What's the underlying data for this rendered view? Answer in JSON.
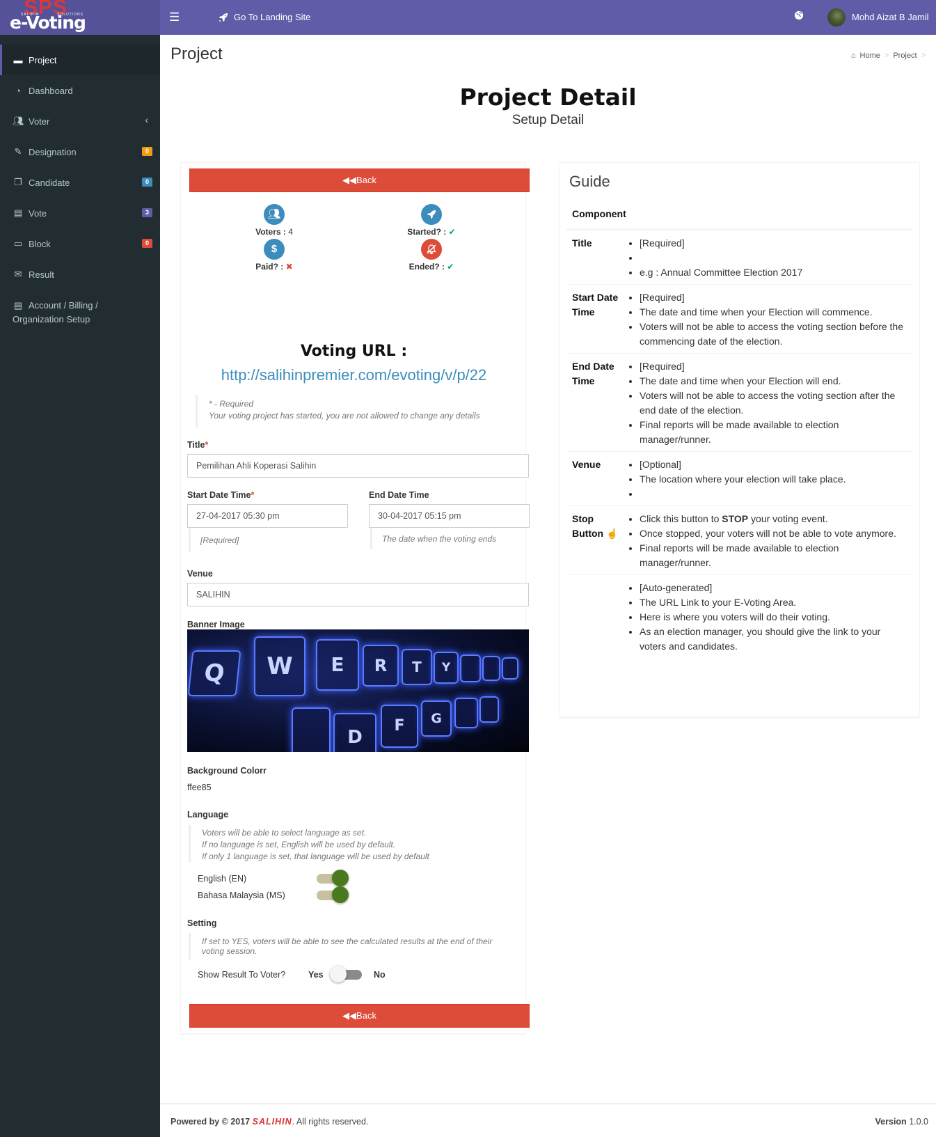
{
  "app": {
    "logo_top": "SPS",
    "logo_tag_left": "SALIHIN",
    "logo_tag_right": "SOLUTIONS",
    "logo_main": "e-Voting",
    "landing_label": "Go To Landing Site",
    "user_name": "Mohd Aizat B Jamil"
  },
  "sidebar": {
    "items": [
      {
        "label": "Project",
        "icon": "briefcase-icon"
      },
      {
        "label": "Dashboard",
        "icon": "dashboard-icon"
      },
      {
        "label": "Voter",
        "icon": "users-icon"
      },
      {
        "label": "Designation",
        "icon": "edit-icon",
        "badge": "0",
        "badge_color": "#f39c12"
      },
      {
        "label": "Candidate",
        "icon": "copy-icon",
        "badge": "0",
        "badge_color": "#3c8dbc"
      },
      {
        "label": "Vote",
        "icon": "book-icon",
        "badge": "3",
        "badge_color": "#605ca8"
      },
      {
        "label": "Block",
        "icon": "laptop-icon",
        "badge": "0",
        "badge_color": "#dd4b39"
      },
      {
        "label": "Result",
        "icon": "envelope-icon"
      }
    ],
    "account_line1": "Account / Billing /",
    "account_line2": "Organization Setup"
  },
  "page": {
    "title": "Project",
    "breadcrumb": [
      "Home",
      "Project"
    ],
    "heading": "Project Detail",
    "subheading": "Setup Detail"
  },
  "form": {
    "back_label": "Back",
    "stats": {
      "voters_label": "Voters :",
      "voters_value": "4",
      "started_label": "Started? :",
      "paid_label": "Paid? :",
      "ended_label": "Ended? :"
    },
    "voting_url_label": "Voting URL :",
    "voting_url": "http://salihinpremier.com/evoting/v/p/22",
    "notice_required": "* - Required",
    "notice_started": "Your voting project has started, you are not allowed to change any details",
    "title_label": "Title",
    "title_value": "Pemilihan Ahli Koperasi Salihin",
    "start_label": "Start Date Time",
    "start_value": "27-04-2017 05:30 pm",
    "start_help": "[Required]",
    "end_label": "End Date Time",
    "end_value": "30-04-2017 05:15 pm",
    "end_help": "The date when the voting ends",
    "venue_label": "Venue",
    "venue_value": "SALIHIN",
    "banner_label": "Banner Image",
    "banner_keys": [
      "Q",
      "W",
      "E",
      "R",
      "T",
      "Y",
      "D",
      "F",
      "G"
    ],
    "bgcolor_label": "Background Colorr",
    "bgcolor_value": "ffee85",
    "language_label": "Language",
    "language_help": [
      "Voters will be able to select language as set.",
      "If no language is set, English will be used by default.",
      "If only 1 language is set, that language will be used by default"
    ],
    "languages": [
      {
        "name": "English (EN)",
        "enabled": true
      },
      {
        "name": "Bahasa Malaysia (MS)",
        "enabled": true
      }
    ],
    "setting_label": "Setting",
    "setting_help": [
      "If set to YES, voters will be able to see the calculated results at the end of their",
      "voting session."
    ],
    "show_result_label": "Show Result To Voter?",
    "yes_label": "Yes",
    "no_label": "No",
    "show_result_enabled": false
  },
  "guide": {
    "title": "Guide",
    "column": "Component",
    "rows": [
      {
        "name": "Title",
        "items": [
          "[Required]",
          "",
          "e.g : Annual Committee Election 2017"
        ]
      },
      {
        "name": "Start Date Time",
        "items": [
          "[Required]",
          "The date and time when your Election will commence.",
          "Voters will not be able to access the voting section before the commencing date of the election."
        ]
      },
      {
        "name": "End Date Time",
        "items": [
          "[Required]",
          "The date and time when your Election will end.",
          "Voters will not be able to access the voting section after the end date of the election.",
          "Final reports will be made available to election manager/runner."
        ]
      },
      {
        "name": "Venue",
        "items": [
          "[Optional]",
          "The location where your election will take place.",
          ""
        ]
      },
      {
        "name": "Stop Button",
        "items": [
          "Click this button to STOP your voting event.",
          "Once stopped, your voters will not be able to vote anymore.",
          "Final reports will be made available to election manager/runner."
        ]
      },
      {
        "name": "",
        "items": [
          "[Auto-generated]",
          "The URL Link to your E-Voting Area.",
          "Here is where you voters will do their voting.",
          "As an election manager, you should give the link to your voters and candidates."
        ]
      }
    ]
  },
  "footer": {
    "powered": "Powered by © 2017",
    "brand": "SALIHIN",
    "rights": ". All rights reserved.",
    "version_label": "Version",
    "version": "1.0.0"
  },
  "colors": {
    "topbar": "#605ca8",
    "sidebar": "#222d32",
    "danger": "#dd4b39",
    "link": "#3c8dbc",
    "toggle_on": "#4a7a1e"
  }
}
